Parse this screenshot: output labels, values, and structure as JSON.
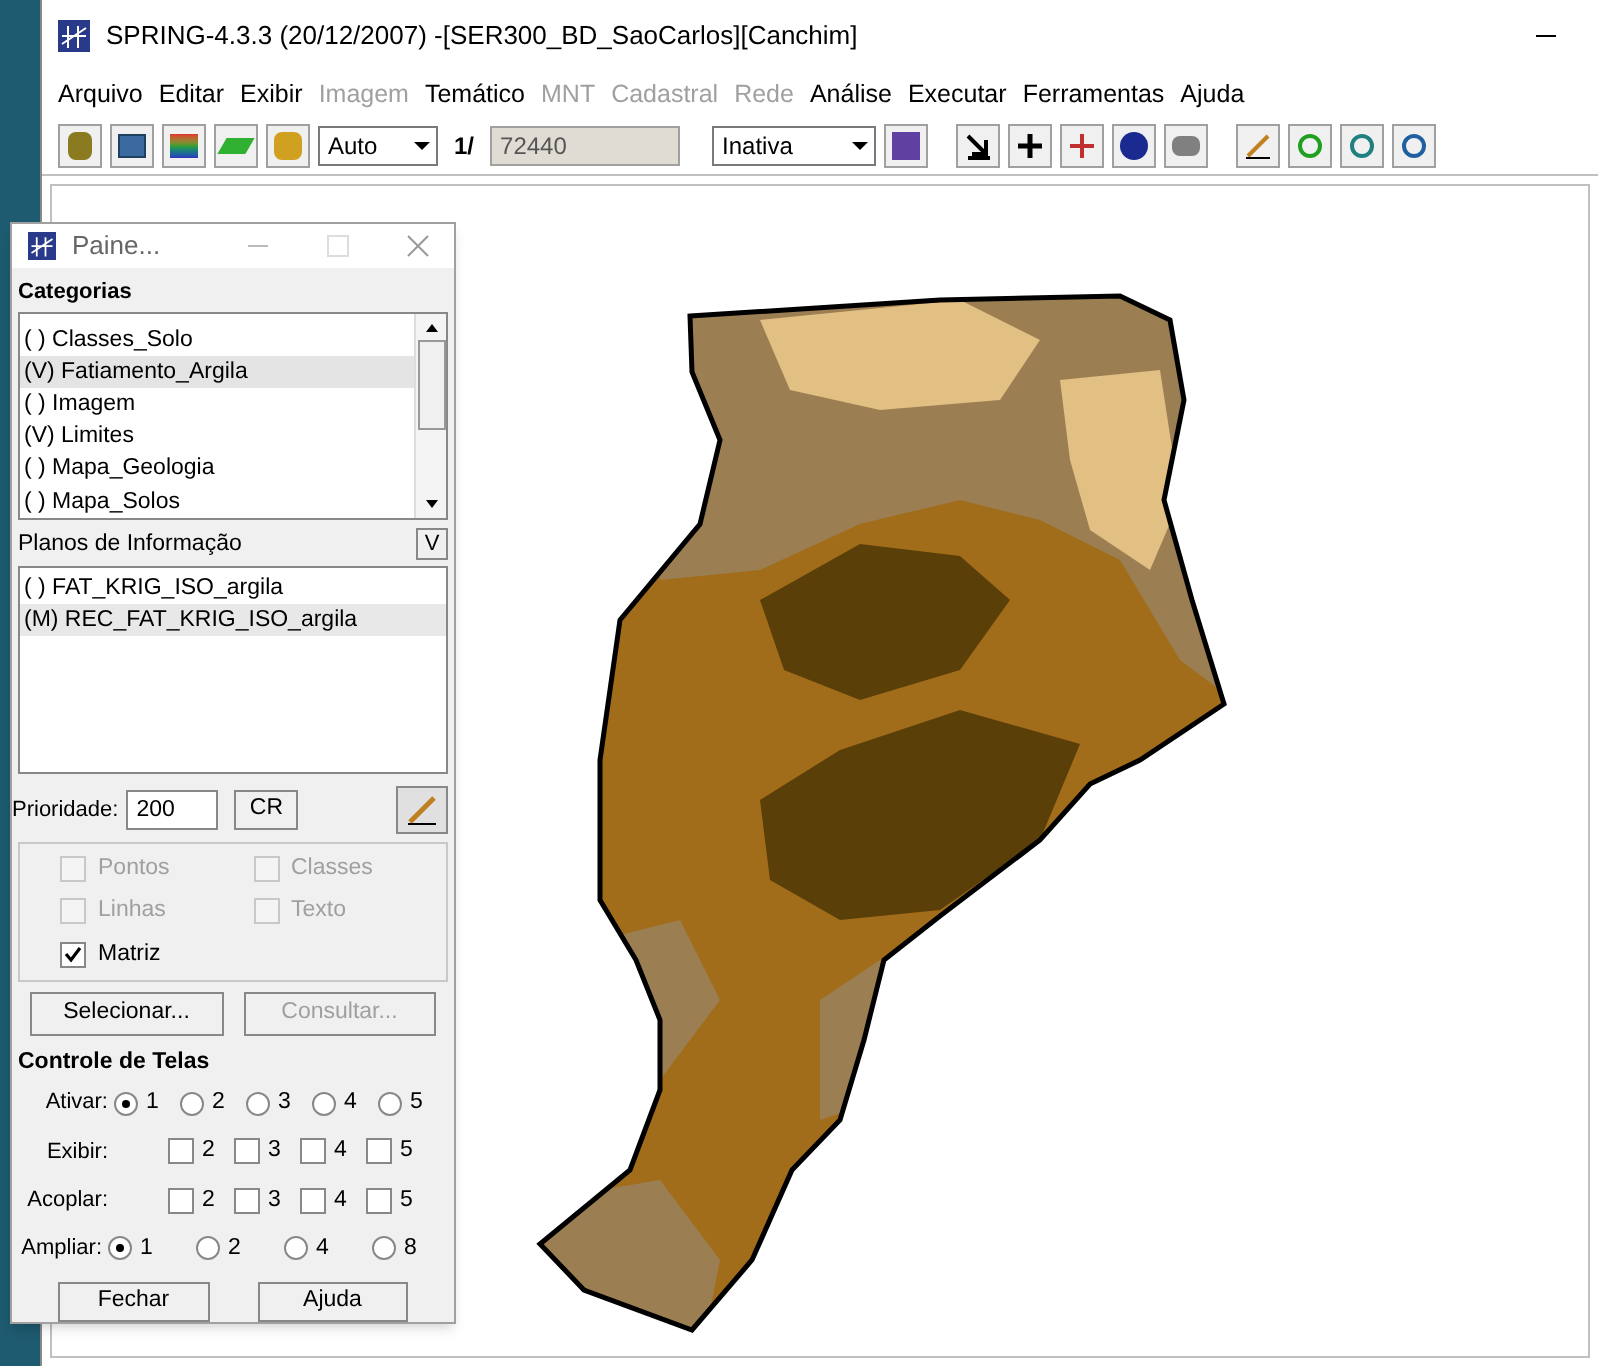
{
  "window": {
    "title": "SPRING-4.3.3 (20/12/2007) -[SER300_BD_SaoCarlos][Canchim]"
  },
  "menu": [
    {
      "label": "Arquivo",
      "disabled": false
    },
    {
      "label": "Editar",
      "disabled": false
    },
    {
      "label": "Exibir",
      "disabled": false
    },
    {
      "label": "Imagem",
      "disabled": true
    },
    {
      "label": "Temático",
      "disabled": false
    },
    {
      "label": "MNT",
      "disabled": true
    },
    {
      "label": "Cadastral",
      "disabled": true
    },
    {
      "label": "Rede",
      "disabled": true
    },
    {
      "label": "Análise",
      "disabled": false
    },
    {
      "label": "Executar",
      "disabled": false
    },
    {
      "label": "Ferramentas",
      "disabled": false
    },
    {
      "label": "Ajuda",
      "disabled": false
    }
  ],
  "toolbar": {
    "scale_mode": "Auto",
    "scale_prefix": "1/",
    "scale": "72440",
    "edit_mode": "Inativa"
  },
  "panel": {
    "title": "Paine...",
    "categories_label": "Categorias",
    "categories": [
      {
        "label": "( ) Classes_Solo",
        "selected": false
      },
      {
        "label": "(V) Fatiamento_Argila",
        "selected": true
      },
      {
        "label": "( ) Imagem",
        "selected": false
      },
      {
        "label": "(V) Limites",
        "selected": false
      },
      {
        "label": "( ) Mapa_Geologia",
        "selected": false
      },
      {
        "label": "( ) Mapa_Solos",
        "selected": false
      }
    ],
    "planes_label": "Planos de Informação",
    "planes_button": "V",
    "planes": [
      {
        "label": "( ) FAT_KRIG_ISO_argila",
        "selected": false
      },
      {
        "label": "(M) REC_FAT_KRIG_ISO_argila",
        "selected": true
      }
    ],
    "priority_label": "Prioridade:",
    "priority": "200",
    "cr_button": "CR",
    "layers": [
      {
        "label": "Pontos",
        "checked": false,
        "disabled": true
      },
      {
        "label": "Classes",
        "checked": false,
        "disabled": true
      },
      {
        "label": "Linhas",
        "checked": false,
        "disabled": true
      },
      {
        "label": "Texto",
        "checked": false,
        "disabled": true
      },
      {
        "label": "Matriz",
        "checked": true,
        "disabled": false
      }
    ],
    "actions": [
      {
        "label": "Selecionar...",
        "disabled": false
      },
      {
        "label": "Consultar...",
        "disabled": true
      }
    ],
    "screens_title": "Controle de Telas",
    "screen_rows": [
      {
        "label": "Ativar:",
        "kind": "radio",
        "options": [
          {
            "label": "1",
            "selected": true
          },
          {
            "label": "2",
            "selected": false
          },
          {
            "label": "3",
            "selected": false
          },
          {
            "label": "4",
            "selected": false
          },
          {
            "label": "5",
            "selected": false
          }
        ]
      },
      {
        "label": "Exibir:",
        "kind": "check",
        "options": [
          {
            "label": "2",
            "checked": false
          },
          {
            "label": "3",
            "checked": false
          },
          {
            "label": "4",
            "checked": false
          },
          {
            "label": "5",
            "checked": false
          }
        ]
      },
      {
        "label": "Acoplar:",
        "kind": "check",
        "options": [
          {
            "label": "2",
            "checked": false
          },
          {
            "label": "3",
            "checked": false
          },
          {
            "label": "4",
            "checked": false
          },
          {
            "label": "5",
            "checked": false
          }
        ]
      },
      {
        "label": "Ampliar:",
        "kind": "radio",
        "options": [
          {
            "label": "1",
            "selected": true
          },
          {
            "label": "2",
            "selected": false
          },
          {
            "label": "4",
            "selected": false
          },
          {
            "label": "8",
            "selected": false
          }
        ]
      }
    ],
    "bottom_buttons": [
      "Fechar",
      "Ajuda"
    ]
  }
}
